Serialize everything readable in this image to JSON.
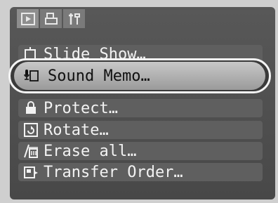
{
  "tabs": [
    {
      "name": "playback",
      "icon": "play-icon",
      "active": true
    },
    {
      "name": "print",
      "icon": "print-icon",
      "active": false
    },
    {
      "name": "setup",
      "icon": "setup-tools-icon",
      "active": false
    }
  ],
  "menu": {
    "items": [
      {
        "label": "Slide Show…",
        "icon": "slide-show-icon"
      },
      {
        "label": "Sound Memo…",
        "icon": "sound-memo-icon",
        "selected": true
      },
      {
        "label": "Protect…",
        "icon": "protect-icon"
      },
      {
        "label": "Rotate…",
        "icon": "rotate-icon"
      },
      {
        "label": "Erase all…",
        "icon": "erase-all-icon"
      },
      {
        "label": "Transfer Order…",
        "icon": "transfer-order-icon"
      }
    ]
  }
}
